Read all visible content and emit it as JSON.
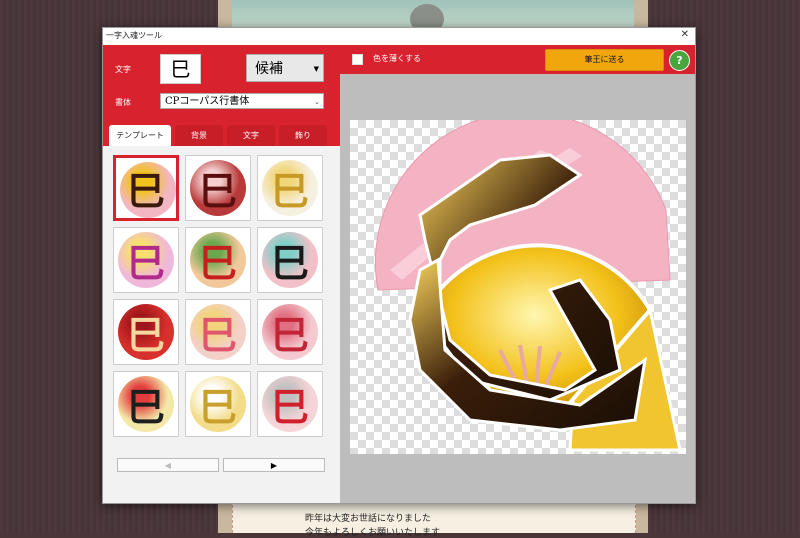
{
  "background": {
    "card_lines": [
      "昨年は大変お世話になりました",
      "今年もよろしくお願いいたします"
    ]
  },
  "dialog": {
    "title": "一字入魂ツール",
    "close_label": "✕",
    "char_label": "文字",
    "char_value": "巳",
    "candidate_label": "候補",
    "font_label": "書体",
    "font_value": "CPコーパス行書体",
    "tabs": [
      "テンプレート",
      "背景",
      "文字",
      "飾り"
    ],
    "templates": [
      {
        "glyph": "巳",
        "bg": "#f3b7c4",
        "fg": "#3a1a0a",
        "accent": "#f1c21c"
      },
      {
        "glyph": "巳",
        "bg": "#b83a3a",
        "fg": "#5a0e0e",
        "accent": "#f4d0d0"
      },
      {
        "glyph": "巳",
        "bg": "#f6f0e0",
        "fg": "#c79a25",
        "accent": "#f1d67a"
      },
      {
        "glyph": "巳",
        "bg": "#f0b8d8",
        "fg": "#b02a8a",
        "accent": "#f7e06e"
      },
      {
        "glyph": "巳",
        "bg": "#f2c89a",
        "fg": "#c52020",
        "accent": "#6aa84f"
      },
      {
        "glyph": "巳",
        "bg": "#f2c0c8",
        "fg": "#1a1a1a",
        "accent": "#80d0c8"
      },
      {
        "glyph": "巳",
        "bg": "#d8302c",
        "fg": "#f6d7a0",
        "accent": "#a0171b"
      },
      {
        "glyph": "巳",
        "bg": "#f3d0c8",
        "fg": "#e0566e",
        "accent": "#f2d47a"
      },
      {
        "glyph": "巳",
        "bg": "#f4c9d0",
        "fg": "#c22438",
        "accent": "#e07080"
      },
      {
        "glyph": "巳",
        "bg": "#f4e8a8",
        "fg": "#1e1e1e",
        "accent": "#e23c3c"
      },
      {
        "glyph": "巳",
        "bg": "#f3dc8a",
        "fg": "#c9a02c",
        "accent": "#ffffff"
      },
      {
        "glyph": "巳",
        "bg": "#f6d5d8",
        "fg": "#d0202c",
        "accent": "#c0c0c0"
      }
    ],
    "pager_prev": "◀",
    "pager_next": "▶",
    "lighten_label": "色を薄くする",
    "send_label": "筆王に送る",
    "help_label": "?",
    "preview_glyph": "巳",
    "colors": {
      "accent_red": "#d8232f",
      "send_orange": "#f2a60e",
      "help_green": "#49a63d"
    }
  }
}
